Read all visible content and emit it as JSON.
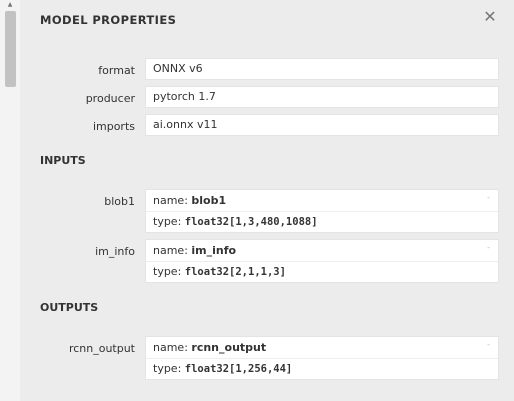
{
  "panel": {
    "title": "MODEL PROPERTIES",
    "close_glyph": "✕"
  },
  "properties": [
    {
      "label": "format",
      "value": "ONNX v6"
    },
    {
      "label": "producer",
      "value": "pytorch 1.7"
    },
    {
      "label": "imports",
      "value": "ai.onnx v11"
    }
  ],
  "inputs": {
    "title": "INPUTS",
    "items": [
      {
        "label": "blob1",
        "name_prefix": "name: ",
        "name": "blob1",
        "type_prefix": "type: ",
        "type": "float32[1,3,480,1088]",
        "expander": "-"
      },
      {
        "label": "im_info",
        "name_prefix": "name: ",
        "name": "im_info",
        "type_prefix": "type: ",
        "type": "float32[2,1,1,3]",
        "expander": "-"
      }
    ]
  },
  "outputs": {
    "title": "OUTPUTS",
    "items": [
      {
        "label": "rcnn_output",
        "name_prefix": "name: ",
        "name": "rcnn_output",
        "type_prefix": "type: ",
        "type": "float32[1,256,44]",
        "expander": "-"
      }
    ]
  },
  "scrollbar": {
    "up_glyph": "▲"
  },
  "icons": {
    "close": "close-icon",
    "scroll_up": "scroll-up-arrow-icon",
    "expand": "expand-icon"
  }
}
